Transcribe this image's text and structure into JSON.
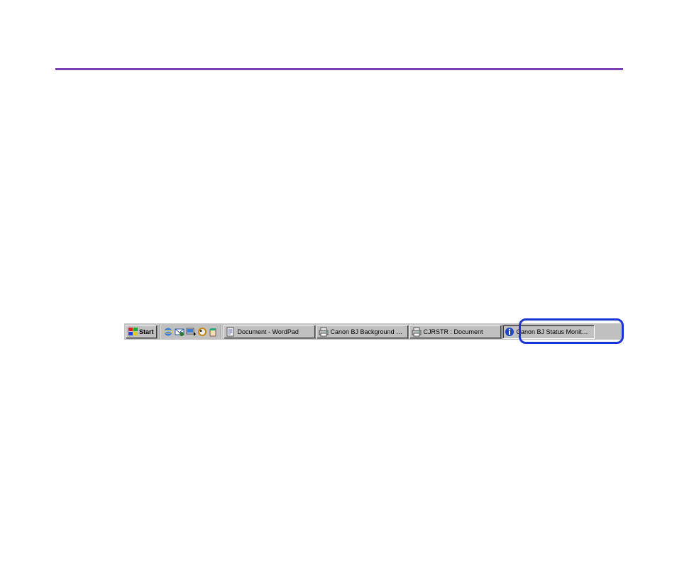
{
  "taskbar": {
    "start_label": "Start",
    "quicklaunch": [
      {
        "name": "ie-icon"
      },
      {
        "name": "outlook-icon"
      },
      {
        "name": "desktop-icon"
      },
      {
        "name": "channels-icon"
      },
      {
        "name": "agent-icon"
      }
    ],
    "tasks": [
      {
        "icon": "document-icon",
        "label": "Document - WordPad"
      },
      {
        "icon": "printer-icon",
        "label": "Canon BJ Background Mo..."
      },
      {
        "icon": "printer-icon",
        "label": "CJRSTR : Document"
      },
      {
        "icon": "info-icon",
        "label": "Canon BJ Status Monitor V..."
      }
    ]
  }
}
